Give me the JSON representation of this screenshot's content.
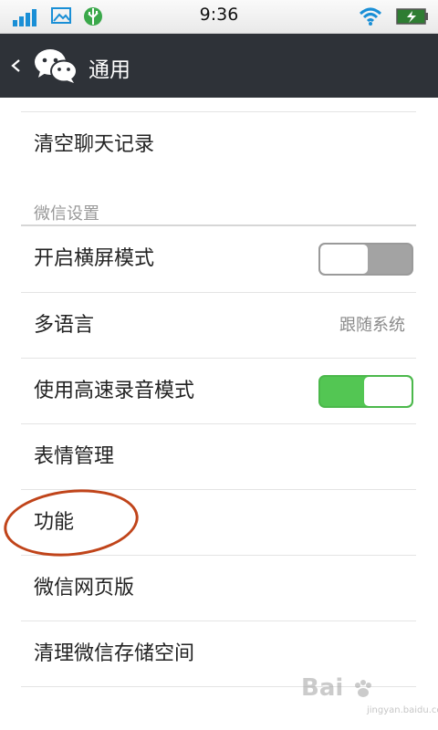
{
  "status_bar": {
    "time": "9:36",
    "icons": [
      "signal-icon",
      "photo-icon",
      "usb-icon",
      "wifi-icon",
      "battery-charging-icon"
    ]
  },
  "header": {
    "back_icon": "chevron-left-icon",
    "app_icon": "wechat-icon",
    "title": "通用"
  },
  "rows": {
    "clear_chat": "清空聊天记录",
    "landscape": "开启横屏模式",
    "language": "多语言",
    "language_value": "跟随系统",
    "hq_voice": "使用高速录音模式",
    "stickers": "表情管理",
    "features": "功能",
    "web_wechat": "微信网页版",
    "storage": "清理微信存储空间"
  },
  "section": {
    "wechat_settings": "微信设置"
  },
  "toggles": {
    "landscape_on": false,
    "hq_voice_on": true
  },
  "colors": {
    "header_bg": "#2e3238",
    "toggle_on": "#53c653",
    "toggle_off": "#a3a3a3",
    "annotation": "#c0441a"
  },
  "watermark": {
    "mark": "Bai",
    "sub": "jingyan.baidu.com"
  }
}
